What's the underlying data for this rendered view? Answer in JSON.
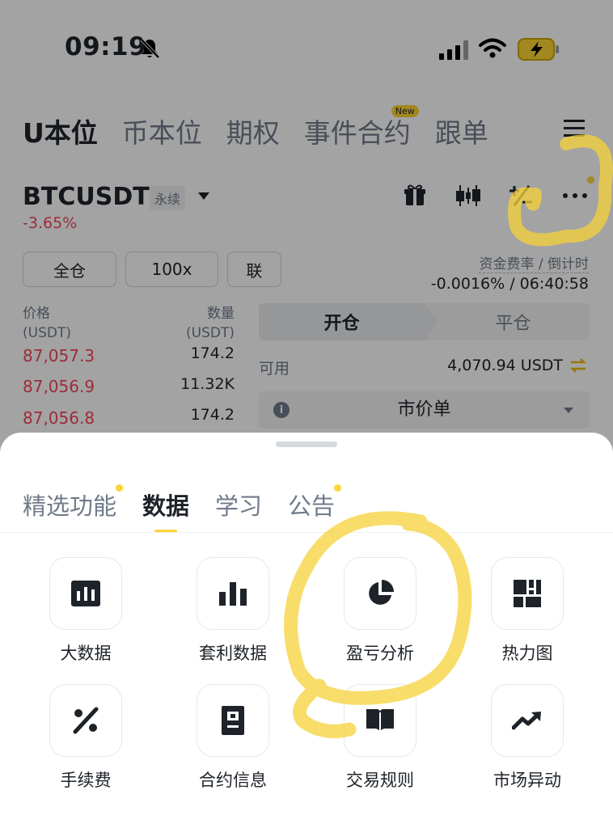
{
  "status_bar": {
    "time": "09:19",
    "icons": [
      "bell-slash-icon",
      "signal-icon",
      "wifi-icon",
      "battery-charging-icon"
    ]
  },
  "top_tabs": [
    {
      "label": "U本位",
      "active": true
    },
    {
      "label": "币本位"
    },
    {
      "label": "期权"
    },
    {
      "label": "事件合约",
      "badge": "New"
    },
    {
      "label": "跟单"
    }
  ],
  "pair": {
    "symbol": "BTCUSDT",
    "type": "永续",
    "change": "-3.65%"
  },
  "chips": {
    "margin_mode": "全仓",
    "leverage": "100x",
    "extra": "联"
  },
  "funding": {
    "label": "资金费率 / 倒计时",
    "value": "-0.0016% / 06:40:58"
  },
  "order_book": {
    "price_header": "价格",
    "price_unit": "(USDT)",
    "qty_header": "数量",
    "qty_unit": "(USDT)",
    "rows": [
      {
        "price": "87,057.3",
        "qty": "174.2"
      },
      {
        "price": "87,056.9",
        "qty": "11.32K"
      },
      {
        "price": "87,056.8",
        "qty": "174.2"
      }
    ]
  },
  "trade": {
    "open_label": "开仓",
    "close_label": "平仓",
    "available_label": "可用",
    "available_value": "4,070.94 USDT",
    "order_type": "市价单"
  },
  "sheet": {
    "tabs": [
      {
        "label": "精选功能",
        "dot": true
      },
      {
        "label": "数据",
        "active": true
      },
      {
        "label": "学习"
      },
      {
        "label": "公告",
        "dot": true
      }
    ],
    "items": [
      {
        "label": "大数据",
        "icon": "bar-chart-box-icon"
      },
      {
        "label": "套利数据",
        "icon": "bar-chart-icon"
      },
      {
        "label": "盈亏分析",
        "icon": "pie-chart-icon"
      },
      {
        "label": "热力图",
        "icon": "heatmap-icon"
      },
      {
        "label": "手续费",
        "icon": "percent-icon"
      },
      {
        "label": "合约信息",
        "icon": "document-icon"
      },
      {
        "label": "交易规则",
        "icon": "book-icon"
      },
      {
        "label": "市场异动",
        "icon": "trend-up-icon"
      }
    ]
  },
  "colors": {
    "accent": "#fcd535",
    "down": "#f6465d",
    "text": "#1e2329",
    "muted": "#707a8a"
  }
}
